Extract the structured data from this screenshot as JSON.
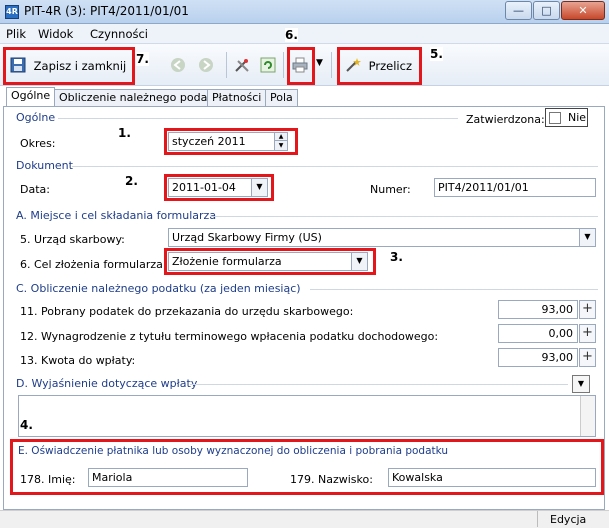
{
  "window": {
    "title": "PIT-4R (3): PIT4/2011/01/01",
    "icon_label": "4R",
    "minimize": "—",
    "maximize": "□",
    "close": "✕"
  },
  "menu": [
    "Plik",
    "Widok",
    "Czynności"
  ],
  "toolbar": {
    "save_label": "Zapisz i zamknij",
    "recalc_label": "Przelicz"
  },
  "markers": {
    "m1": "1.",
    "m2": "2.",
    "m3": "3.",
    "m4": "4.",
    "m5": "5.",
    "m6": "6.",
    "m7": "7."
  },
  "tabs": [
    "Ogólne",
    "Obliczenie należnego podatku",
    "Płatności",
    "Pola"
  ],
  "general": {
    "section": "Ogólne",
    "okres_label": "Okres:",
    "okres_value": "styczeń 2011",
    "zatwierdzona_label": "Zatwierdzona:",
    "zatwierdzona_value": "Nie"
  },
  "document": {
    "section": "Dokument",
    "data_label": "Data:",
    "data_value": "2011-01-04",
    "numer_label": "Numer:",
    "numer_value": "PIT4/2011/01/01"
  },
  "sectionA": {
    "title": "A. Miejsce i cel składania formularza",
    "urzad_label": "5. Urząd skarbowy:",
    "urzad_value": "Urząd Skarbowy Firmy (US)",
    "cel_label": "6. Cel złożenia formularza:",
    "cel_value": "Złożenie formularza"
  },
  "sectionC": {
    "title": "C. Obliczenie należnego podatku (za jeden miesiąc)",
    "rows": [
      {
        "label": "11. Pobrany podatek  do przekazania do urzędu skarbowego:",
        "value": "93,00"
      },
      {
        "label": "12. Wynagrodzenie z tytułu terminowego wpłacenia podatku dochodowego:",
        "value": "0,00"
      },
      {
        "label": "13. Kwota do wpłaty:",
        "value": "93,00"
      }
    ]
  },
  "sectionD": {
    "title": "D. Wyjaśnienie dotyczące wpłaty",
    "value": ""
  },
  "sectionE": {
    "title": "E. Oświadczenie płatnika lub osoby wyznaczonej do obliczenia i pobrania podatku",
    "imie_label": "178. Imię:",
    "imie_value": "Mariola",
    "nazwisko_label": "179. Nazwisko:",
    "nazwisko_value": "Kowalska"
  },
  "status": {
    "mode": "Edycja"
  },
  "colors": {
    "highlight": "#e3161b",
    "section_title": "#1e3d8a"
  }
}
